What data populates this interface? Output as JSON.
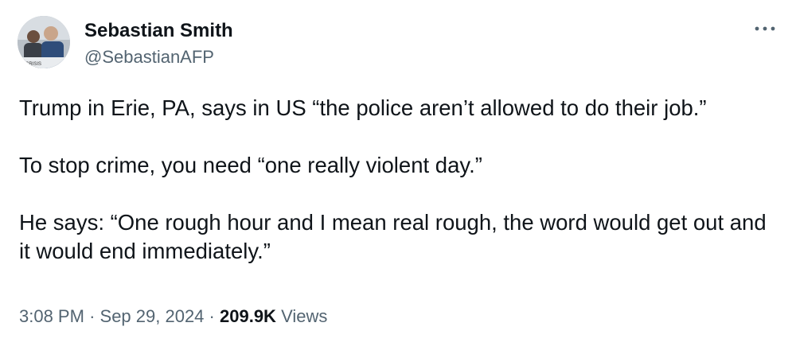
{
  "author": {
    "display_name": "Sebastian Smith",
    "handle": "@SebastianAFP",
    "avatar_caption": "CRISIS"
  },
  "menu": {
    "more_label": "•••"
  },
  "tweet": {
    "paragraphs": [
      "Trump in Erie, PA, says in US “the police aren’t allowed to do their job.”",
      "To stop crime, you need “one really violent day.”",
      "He says: “One rough hour and I mean real rough, the word would get out and it would end immediately.”"
    ]
  },
  "meta": {
    "time": "3:08 PM",
    "separator": "·",
    "date": "Sep 29, 2024",
    "views_count": "209.9K",
    "views_label": "Views"
  },
  "colors": {
    "text_primary": "#0f1419",
    "text_secondary": "#536471",
    "background": "#ffffff"
  }
}
